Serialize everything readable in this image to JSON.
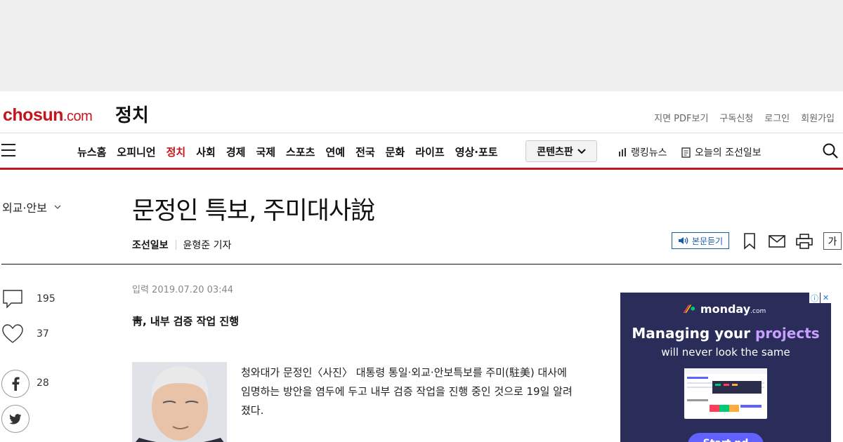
{
  "site": {
    "logo_main": "chosun",
    "logo_suffix": ".com",
    "section": "정치",
    "util_links": [
      "지면 PDF보기",
      "구독신청",
      "로그인",
      "회원가입"
    ]
  },
  "nav": {
    "items": [
      "뉴스홈",
      "오피니언",
      "정치",
      "사회",
      "경제",
      "국제",
      "스포츠",
      "연예",
      "전국",
      "문화",
      "라이프",
      "영상·포토"
    ],
    "active": "정치",
    "content_button": "콘텐츠판",
    "ranking": "랭킹뉴스",
    "today": "오늘의 조선일보"
  },
  "article": {
    "subcategory": "외교·안보",
    "headline": "문정인 특보, 주미대사說",
    "publisher": "조선일보",
    "reporter": "윤형준 기자",
    "listen_label": "본문듣기",
    "font_label": "가",
    "date": "입력 2019.07.20 03:44",
    "subhead": "靑, 내부 검증 작업 진행",
    "body_lines": [
      "청와대가 문정인〈사진〉 대통령 통일·외교·안보특보를 주미(駐美) 대사에",
      "임명하는 방안을 염두에 두고 내부 검증 작업을 진행 중인 것으로 19일 알려",
      "졌다."
    ]
  },
  "side": {
    "comments": "195",
    "likes": "37",
    "facebook": "28"
  },
  "ad": {
    "brand": "monday",
    "brand_suffix": ".com",
    "line1_a": "Managing your ",
    "line1_b": "projects",
    "line2": "will never look the same",
    "cta": "Start nd"
  },
  "colors": {
    "brand_red": "#c5141d",
    "listen_blue": "#1a5ba8",
    "ad_bg": "#2a2c5a",
    "ad_accent": "#6161ff"
  }
}
